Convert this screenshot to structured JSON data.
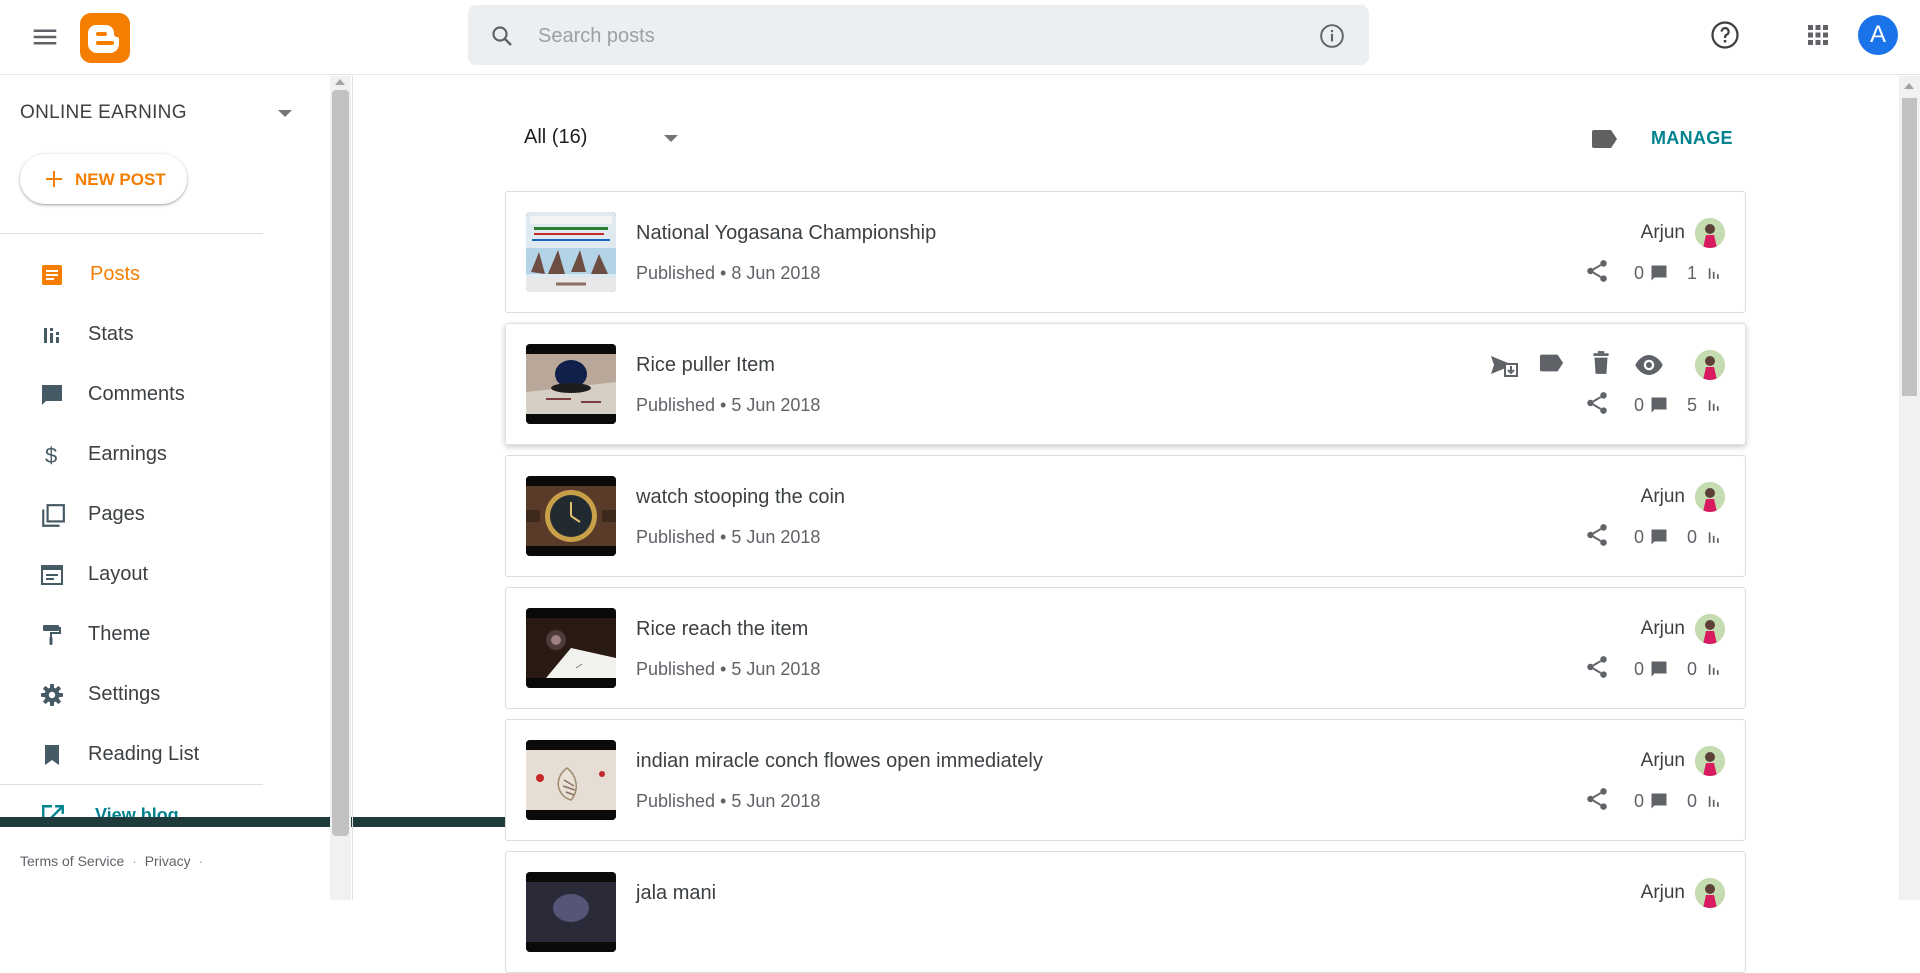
{
  "topbar": {
    "search_placeholder": "Search posts",
    "avatar_letter": "A",
    "icons": [
      "menu-icon",
      "blogger-logo",
      "search-icon",
      "info-icon",
      "help-icon",
      "apps-icon"
    ]
  },
  "sidebar": {
    "blog_name": "ONLINE EARNING",
    "new_post_label": "NEW POST",
    "items": [
      {
        "label": "Posts",
        "icon": "posts-icon",
        "active": true
      },
      {
        "label": "Stats",
        "icon": "stats-icon"
      },
      {
        "label": "Comments",
        "icon": "comments-icon"
      },
      {
        "label": "Earnings",
        "icon": "dollar-icon"
      },
      {
        "label": "Pages",
        "icon": "pages-icon"
      },
      {
        "label": "Layout",
        "icon": "layout-icon"
      },
      {
        "label": "Theme",
        "icon": "paint-roller-icon"
      },
      {
        "label": "Settings",
        "icon": "gear-icon"
      },
      {
        "label": "Reading List",
        "icon": "bookmark-icon"
      }
    ],
    "view_blog_label": "View blog",
    "footer": {
      "terms": "Terms of Service",
      "privacy": "Privacy"
    }
  },
  "main": {
    "filter_label": "All (16)",
    "manage_label": "MANAGE",
    "posts": [
      {
        "title": "National Yogasana Championship",
        "status": "Published • 8 Jun 2018",
        "author": "Arjun",
        "comments": "0",
        "views": "1"
      },
      {
        "title": "Rice puller Item",
        "status": "Published • 5 Jun 2018",
        "author": "",
        "comments": "0",
        "views": "5"
      },
      {
        "title": "watch stooping the coin",
        "status": "Published • 5 Jun 2018",
        "author": "Arjun",
        "comments": "0",
        "views": "0"
      },
      {
        "title": "Rice reach the item",
        "status": "Published • 5 Jun 2018",
        "author": "Arjun",
        "comments": "0",
        "views": "0"
      },
      {
        "title": "indian miracle conch flowes open immediately",
        "status": "Published • 5 Jun 2018",
        "author": "Arjun",
        "comments": "0",
        "views": "0"
      },
      {
        "title": "jala mani",
        "status": "",
        "author": "Arjun",
        "comments": "",
        "views": ""
      }
    ]
  },
  "colors": {
    "brand": "#f57d00",
    "teal": "#00838f",
    "text": "#3c4043",
    "muted": "#5f6368"
  }
}
